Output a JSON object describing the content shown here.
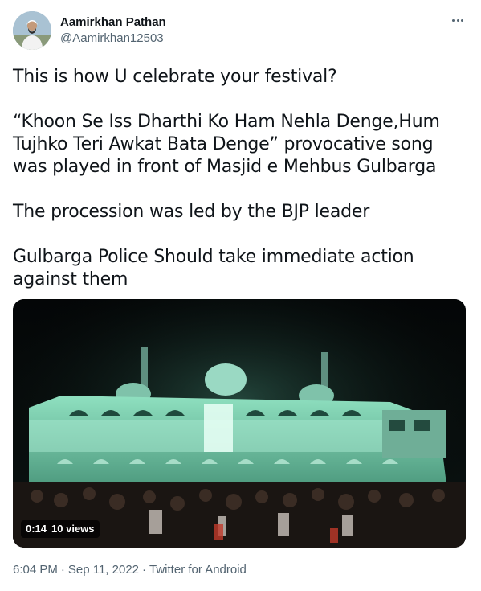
{
  "author": {
    "display_name": "Aamirkhan Pathan",
    "handle": "@Aamirkhan12503",
    "avatar_icon": "profile-photo"
  },
  "more_icon": "more-options-icon",
  "tweet": {
    "paragraphs": [
      "This is how U celebrate your festival?",
      "“Khoon Se Iss Dharthi Ko Ham Nehla Denge,Hum Tujhko Teri Awkat Bata Denge” provocative song was played in front of Masjid e Mehbus Gulbarga",
      "The procession was led by the BJP leader",
      "Gulbarga Police Should take immediate action against them"
    ]
  },
  "video": {
    "duration": "0:14",
    "views": "10 views"
  },
  "meta": {
    "time": "6:04 PM",
    "date": "Sep 11, 2022",
    "separator": "·",
    "source": "Twitter for Android"
  },
  "colors": {
    "text": "#0f1419",
    "secondary": "#536471",
    "mosque_glow": "#7fd6b3"
  }
}
